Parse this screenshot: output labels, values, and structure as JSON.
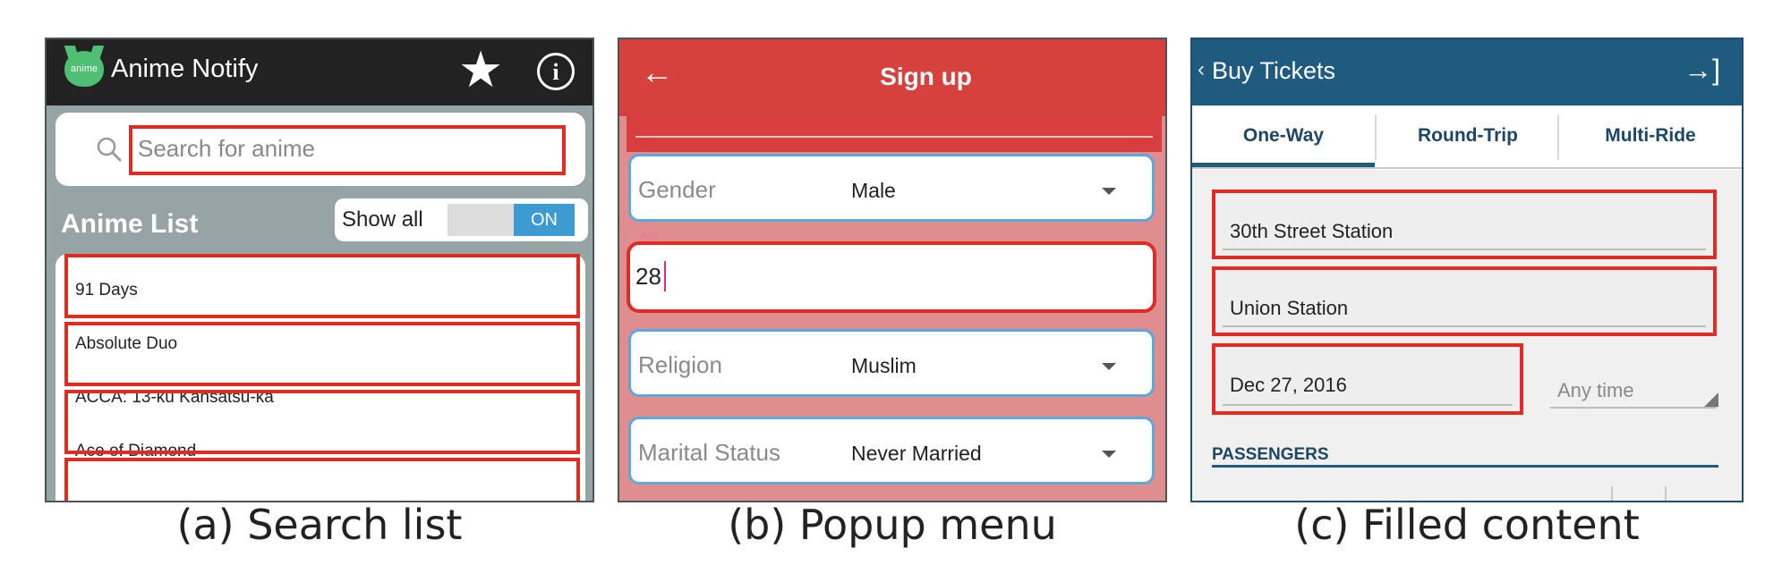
{
  "panel_a": {
    "app_title": "Anime Notify",
    "logo_text": "anime",
    "star_icon": "★",
    "info_icon": "i",
    "search_placeholder": "Search for anime",
    "list_title": "Anime List",
    "toggle_label": "Show all",
    "toggle_state": "ON",
    "items": [
      "91 Days",
      "Absolute Duo",
      "ACCA: 13-ku Kansatsu-ka",
      "Ace of Diamond"
    ],
    "caption": "(a) Search list"
  },
  "panel_b": {
    "back_icon": "←",
    "title": "Sign up",
    "gender_label": "Gender",
    "gender_value": "Male",
    "age_value": "28",
    "religion_label": "Religion",
    "religion_value": "Muslim",
    "marital_label": "Marital Status",
    "marital_value": "Never Married",
    "caption": "(b) Popup menu"
  },
  "panel_c": {
    "back_icon": "‹",
    "title": "Buy Tickets",
    "exit_icon": "→]",
    "tabs": [
      "One-Way",
      "Round-Trip",
      "Multi-Ride"
    ],
    "from_station": "30th Street Station",
    "to_station": "Union Station",
    "date": "Dec 27, 2016",
    "time": "Any time",
    "passengers_header": "PASSENGERS",
    "caption": "(c) Filled content"
  },
  "colors": {
    "highlight": "#e02a24",
    "panel_b_bar": "#d6403d",
    "panel_c_bar": "#1f5a7f",
    "toggle_on": "#3d9bd1"
  }
}
